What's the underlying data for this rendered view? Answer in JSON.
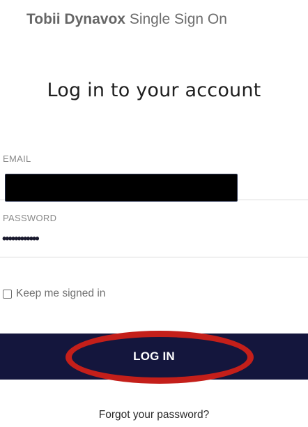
{
  "header": {
    "brand_bold": "Tobii Dynavox",
    "brand_rest": "Single Sign On"
  },
  "form": {
    "title": "Log in to your account",
    "email_label": "EMAIL",
    "email_value": "",
    "password_label": "PASSWORD",
    "password_mask": "••••••••••••",
    "keep_signed_in_label": "Keep me signed in",
    "keep_signed_in_checked": false,
    "login_button_label": "LOG IN",
    "forgot_password_link": "Forgot your password?"
  },
  "colors": {
    "button_background": "#14163d",
    "highlight_ring": "#c41f1a",
    "redaction": "#000000"
  }
}
